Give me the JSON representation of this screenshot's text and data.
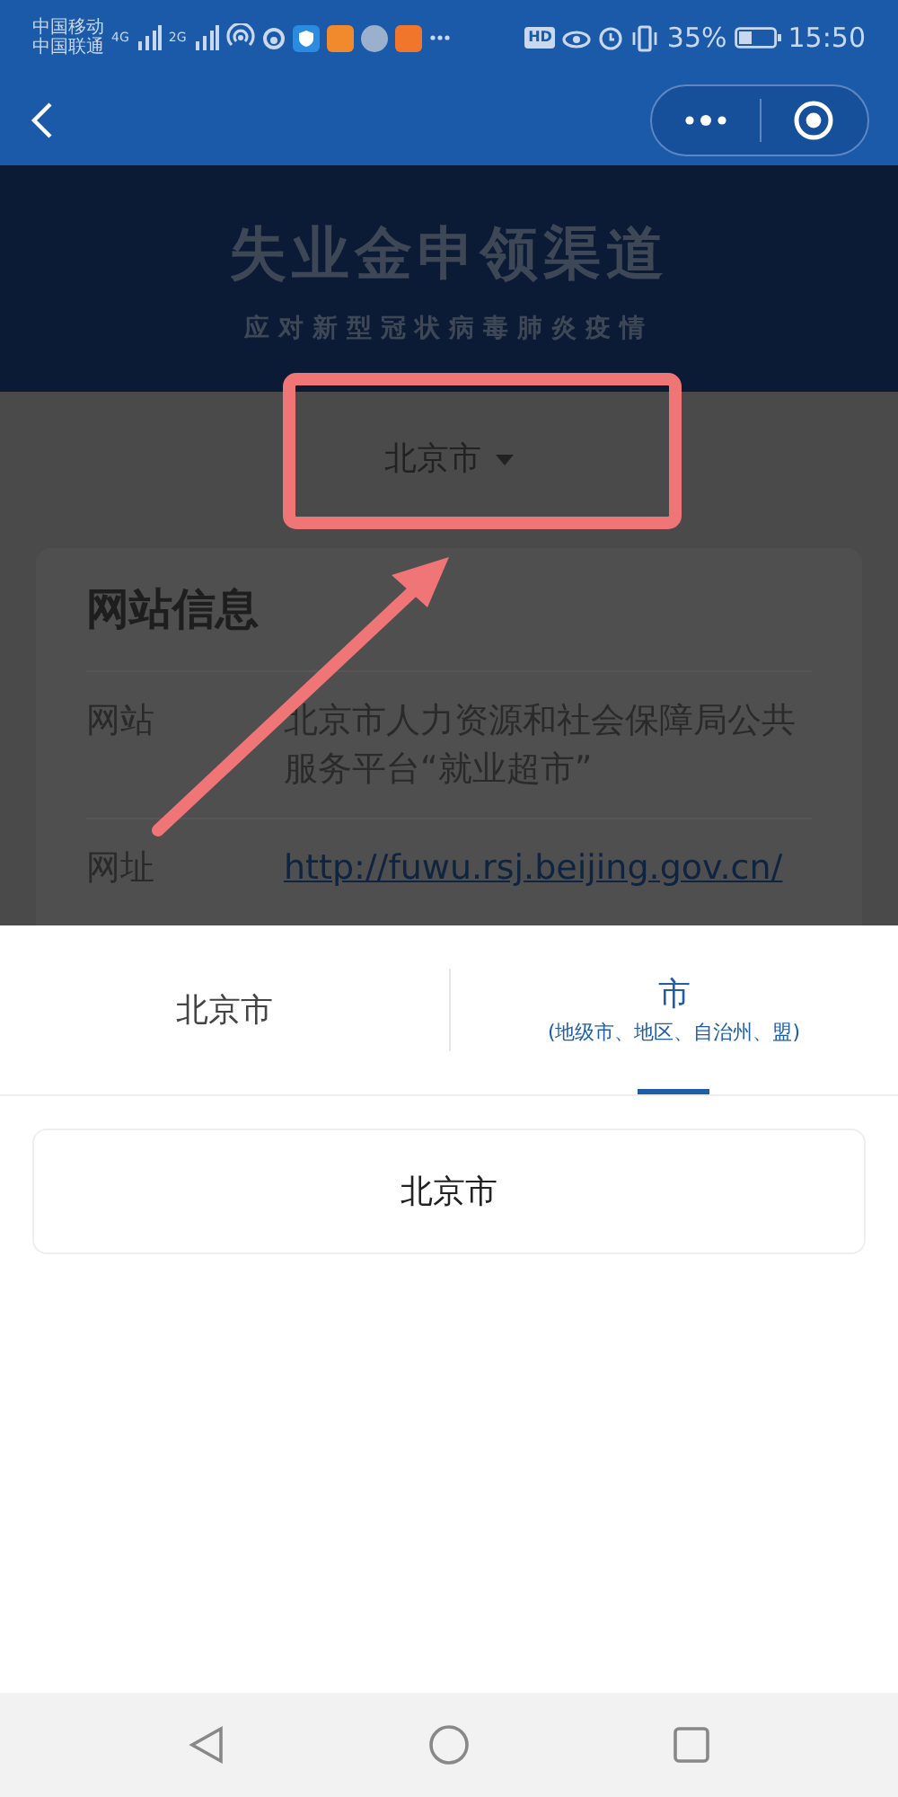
{
  "status_bar": {
    "carriers": [
      "中国移动",
      "中国联通"
    ],
    "network_tags": [
      "4G",
      "2G"
    ],
    "hd_tag": "HD",
    "battery": "35%",
    "time": "15:50"
  },
  "banner": {
    "title": "失业金申领渠道",
    "subtitle": "应对新型冠状病毒肺炎疫情"
  },
  "region_picker": {
    "value": "北京市"
  },
  "card": {
    "title": "网站信息",
    "rows": [
      {
        "label": "网站",
        "value": "北京市人力资源和社会保障局公共服务平台“就业超市”",
        "kind": "text"
      },
      {
        "label": "网址",
        "value": "http://fuwu.rsj.beijing.gov.cn/",
        "kind": "link"
      }
    ]
  },
  "sheet": {
    "tabs": [
      {
        "label": "北京市",
        "selected": false
      },
      {
        "label": "市",
        "hint": "(地级市、地区、自治州、盟)",
        "selected": true
      }
    ],
    "options": [
      "北京市"
    ]
  }
}
